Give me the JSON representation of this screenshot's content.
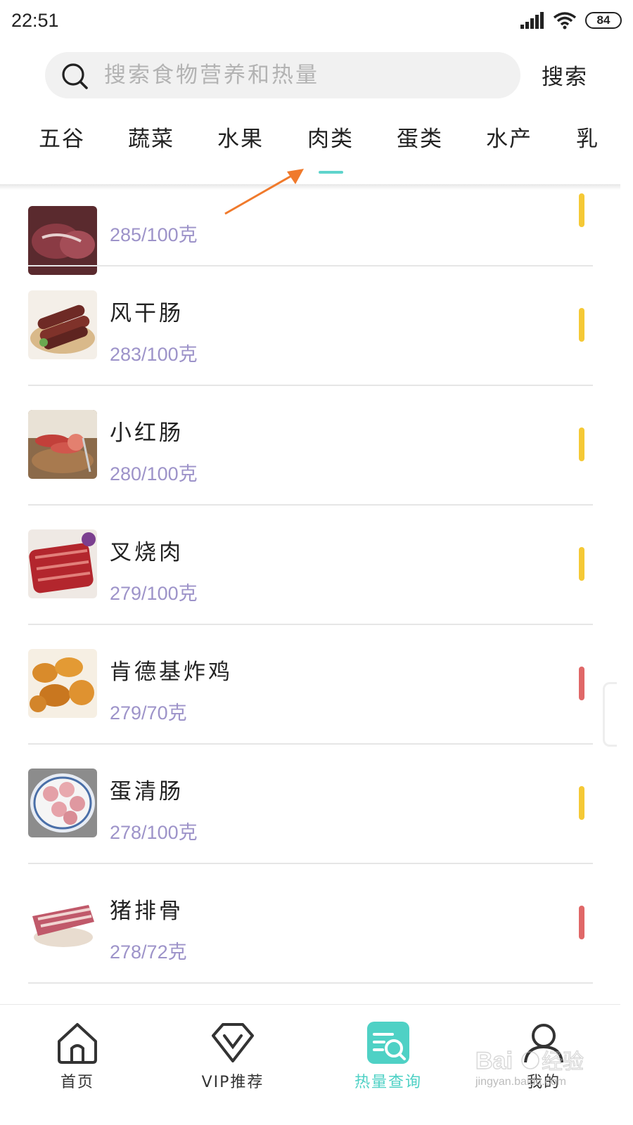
{
  "status_bar": {
    "time": "22:51",
    "battery": "84"
  },
  "search": {
    "placeholder": "搜索食物营养和热量",
    "button_label": "搜索"
  },
  "tabs": [
    {
      "label": "五谷"
    },
    {
      "label": "蔬菜"
    },
    {
      "label": "水果"
    },
    {
      "label": "肉类",
      "active": true
    },
    {
      "label": "蛋类"
    },
    {
      "label": "水产"
    },
    {
      "label": "乳"
    }
  ],
  "accent_color": "#4fd1c5",
  "calorie_text_color": "#9d93c9",
  "level_colors": {
    "yellow": "#f5c936",
    "red": "#e06868"
  },
  "items": [
    {
      "name": "",
      "calories": "285/100克",
      "level": "yellow"
    },
    {
      "name": "风干肠",
      "calories": "283/100克",
      "level": "yellow"
    },
    {
      "name": "小红肠",
      "calories": "280/100克",
      "level": "yellow"
    },
    {
      "name": "叉烧肉",
      "calories": "279/100克",
      "level": "yellow"
    },
    {
      "name": "肯德基炸鸡",
      "calories": "279/70克",
      "level": "red"
    },
    {
      "name": "蛋清肠",
      "calories": "278/100克",
      "level": "yellow"
    },
    {
      "name": "猪排骨",
      "calories": "278/72克",
      "level": "red"
    }
  ],
  "bottom_nav": [
    {
      "label": "首页",
      "icon": "home-icon"
    },
    {
      "label": "VIP推荐",
      "icon": "vip-icon"
    },
    {
      "label": "热量查询",
      "icon": "calorie-search-icon",
      "active": true
    },
    {
      "label": "我的",
      "icon": "profile-icon"
    }
  ],
  "watermark": {
    "logo": "Bai经验",
    "url": "jingyan.baidu.com"
  }
}
